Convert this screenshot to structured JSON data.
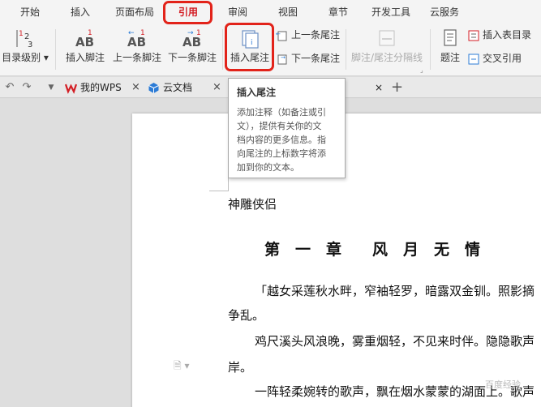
{
  "menu": {
    "tabs": [
      {
        "label": "开始"
      },
      {
        "label": "插入"
      },
      {
        "label": "页面布局"
      },
      {
        "label": "引用"
      },
      {
        "label": "审阅"
      },
      {
        "label": "视图"
      },
      {
        "label": "章节"
      },
      {
        "label": "开发工具"
      },
      {
        "label": "云服务"
      }
    ],
    "active_color": "#d31d24"
  },
  "ribbon": {
    "toc_level": "目录级别",
    "insert_footnote": "插入脚注",
    "prev_footnote": "上一条脚注",
    "next_footnote": "下一条脚注",
    "insert_endnote": "插入尾注",
    "prev_endnote": "上一条尾注",
    "next_endnote": "下一条尾注",
    "separator": "脚注/尾注分隔线",
    "caption": "题注",
    "insert_table_of_figures": "插入表目录",
    "cross_reference": "交叉引用"
  },
  "tabs": {
    "my_wps": "我的WPS",
    "cloud_docs": "云文档"
  },
  "tooltip": {
    "title": "插入尾注",
    "lines": [
      "添加注释（如备注或引",
      "文），提供有关你的文",
      "档内容的更多信息。指",
      "向尾注的上标数字将添",
      "加到你的文本。"
    ]
  },
  "document": {
    "book_title": "神雕侠侣",
    "chapter_title": "第　一　章　　风　月　无　情",
    "p1_line1": "「越女采莲秋水畔，窄袖轻罗，暗露双金钏。照影摘",
    "p1_line2": "争乱。",
    "p2_line1": "鸡尺溪头风浪晚，雾重烟轻，不见来时伴。隐隐歌声",
    "p2_line2": "岸。",
    "p3_line1": "一阵轻柔婉转的歌声，飘在烟水蒙蒙的湖面上。歌声"
  },
  "watermark": "百度经验",
  "highlight_color": "#e2231a"
}
